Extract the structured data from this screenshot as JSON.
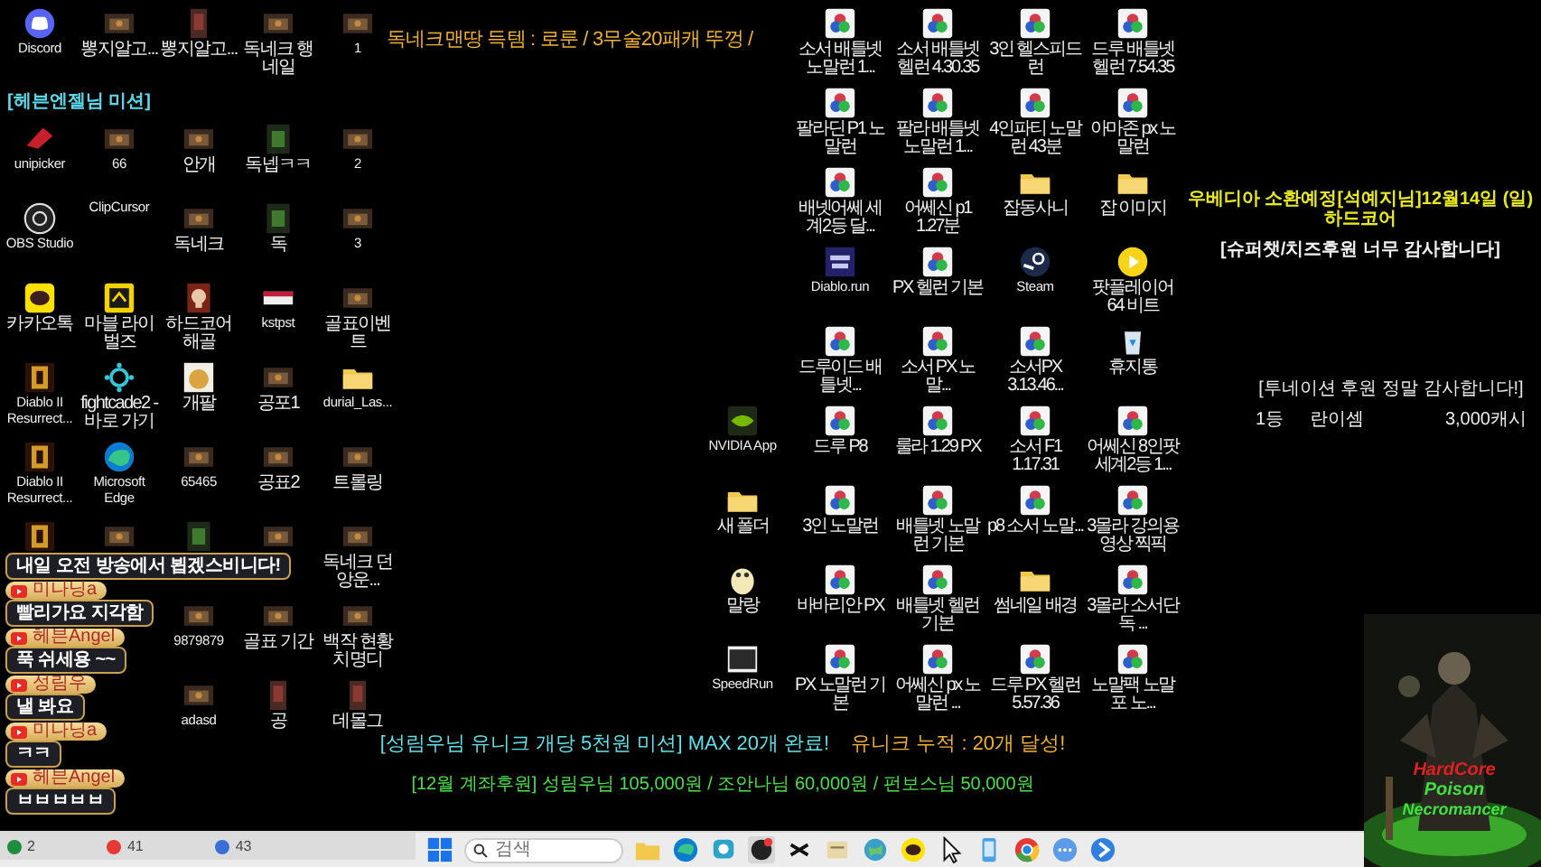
{
  "desktop_left": {
    "first_row": [
      {
        "kind": "discord",
        "label": "Discord"
      },
      {
        "kind": "thumb",
        "label": "뽕지알고..."
      },
      {
        "kind": "doc",
        "label": "뽕지알고..."
      },
      {
        "kind": "thumb",
        "label": "독네크 행네일"
      },
      {
        "kind": "thumb",
        "label": "1"
      }
    ],
    "mission_label": "[헤븐엔젤님 미션]",
    "rows": [
      [
        {
          "kind": "unipicker",
          "label": "unipicker"
        },
        {
          "kind": "thumb",
          "label": "66"
        },
        {
          "kind": "thumb",
          "label": "안개"
        },
        {
          "kind": "thumbg",
          "label": "독넵ㅋㅋ"
        },
        {
          "kind": "thumb",
          "label": "2"
        }
      ],
      [
        {
          "kind": "obs",
          "label": "OBS Studio"
        },
        {
          "kind": "blank",
          "label": "ClipCursor"
        },
        {
          "kind": "thumb",
          "label": "독네크"
        },
        {
          "kind": "thumbg",
          "label": "독"
        },
        {
          "kind": "thumb",
          "label": "3"
        }
      ],
      [
        {
          "kind": "talk",
          "label": "카카오톡"
        },
        {
          "kind": "marvel",
          "label": "마블 라이벌즈"
        },
        {
          "kind": "skull",
          "label": "하드코어 해골"
        },
        {
          "kind": "banner",
          "label": "kstpst"
        },
        {
          "kind": "thumb",
          "label": "골표이벤트"
        }
      ],
      [
        {
          "kind": "diablo",
          "label": "Diablo II Resurrect..."
        },
        {
          "kind": "hub",
          "label": "fightcade2 - 바로 가기"
        },
        {
          "kind": "dog",
          "label": "개팔"
        },
        {
          "kind": "thumb",
          "label": "공포1"
        },
        {
          "kind": "folder",
          "label": "durial_Las..."
        }
      ],
      [
        {
          "kind": "diablo",
          "label": "Diablo II Resurrect..."
        },
        {
          "kind": "edge",
          "label": "Microsoft Edge"
        },
        {
          "kind": "thumb",
          "label": "65465"
        },
        {
          "kind": "thumb",
          "label": "공표2"
        },
        {
          "kind": "thumb",
          "label": "트롤링"
        }
      ],
      [
        {
          "kind": "diablo"
        },
        {
          "kind": "thumb"
        },
        {
          "kind": "thumbg"
        },
        {
          "kind": "thumb"
        },
        {
          "kind": "thumb",
          "label": "독네크 던앙운..."
        }
      ],
      [
        null,
        null,
        {
          "kind": "thumb",
          "label": "9879879"
        },
        {
          "kind": "thumb",
          "label": "골표 기간"
        },
        {
          "kind": "thumb",
          "label": "백작 현황 치명디"
        }
      ],
      [
        null,
        null,
        {
          "kind": "thumb",
          "label": "adasd"
        },
        {
          "kind": "doc",
          "label": "공"
        },
        {
          "kind": "doc",
          "label": "데몰그"
        }
      ]
    ]
  },
  "desktop_right": {
    "rows": [
      [
        null,
        {
          "kind": "circles",
          "label": "소서 배틀넷 노말런 1..."
        },
        {
          "kind": "circles",
          "label": "소서 배틀넷 헬런 4.30.35"
        },
        {
          "kind": "circles",
          "label": "3인 헬스피드런"
        },
        {
          "kind": "circles",
          "label": "드루 배틀넷 헬런 7.54.35"
        }
      ],
      [
        null,
        {
          "kind": "circles",
          "label": "팔라딘 P1 노말런"
        },
        {
          "kind": "circles",
          "label": "팔라 배틀넷 노말런 1..."
        },
        {
          "kind": "circles",
          "label": "4인파티 노말런 43분"
        },
        {
          "kind": "circles",
          "label": "아마존 px 노말런"
        }
      ],
      [
        null,
        {
          "kind": "circles",
          "label": "배넷어쎄 세계2등 달..."
        },
        {
          "kind": "circles",
          "label": "어쎄신 p1 1.27분"
        },
        {
          "kind": "folder",
          "label": "잡동사니"
        },
        {
          "kind": "folder",
          "label": "잡 이미지"
        }
      ],
      [
        null,
        {
          "kind": "run",
          "label": "Diablo.run"
        },
        {
          "kind": "circles",
          "label": "PX 헬런 기본"
        },
        {
          "kind": "steam",
          "label": "Steam"
        },
        {
          "kind": "play",
          "label": "팟플레이어 64 비트"
        }
      ],
      [
        null,
        {
          "kind": "circles",
          "label": "드루이드 배틀넷..."
        },
        {
          "kind": "circles",
          "label": "소서 PX 노말..."
        },
        {
          "kind": "circles",
          "label": "소서PX 3.13.46..."
        },
        {
          "kind": "bin",
          "label": "휴지통"
        }
      ],
      [
        {
          "kind": "nvidia",
          "label": "NVIDIA App"
        },
        {
          "kind": "circles",
          "label": "드루 P8"
        },
        {
          "kind": "circles",
          "label": "룰라 1.29 PX"
        },
        {
          "kind": "circles",
          "label": "소서 F1 1.17.31"
        },
        {
          "kind": "circles",
          "label": "어쎄신 8인팟 세계2등 1..."
        }
      ],
      [
        {
          "kind": "folder",
          "label": "새 폴더"
        },
        {
          "kind": "circles",
          "label": "3인 노말런"
        },
        {
          "kind": "circles",
          "label": "배틀넷 노말런 기본"
        },
        {
          "kind": "circles",
          "label": "p8 소서 노말..."
        },
        {
          "kind": "circles",
          "label": "3몰라 강의용 영상 찍픽"
        }
      ],
      [
        {
          "kind": "mallang",
          "label": "말랑"
        },
        {
          "kind": "circles",
          "label": "바바리안 PX"
        },
        {
          "kind": "circles",
          "label": "배틀넷 헬런 기본"
        },
        {
          "kind": "folder",
          "label": "썸네일 배경"
        },
        {
          "kind": "circles",
          "label": "3몰라 소서단독 ..."
        }
      ],
      [
        {
          "kind": "speed",
          "label": "SpeedRun"
        },
        {
          "kind": "circles",
          "label": "PX 노말런 기본"
        },
        {
          "kind": "circles",
          "label": "어쎄신 px 노말런 ..."
        },
        {
          "kind": "circles",
          "label": "드루 PX 헬런 5.57.36"
        },
        {
          "kind": "circles",
          "label": "노말팩 노말포 노..."
        }
      ]
    ]
  },
  "loot_text": "독네크맨땅 득템 : 로룬 / 3무술20패캐 뚜껑 /",
  "summon_notice": {
    "title": "우베디아 소환예정[석예지님]12월14일 (일) 하드코어",
    "subtitle": "[슈퍼챗/치즈후원 너무 감사합니다]"
  },
  "donation_board": {
    "title": "[투네이션 후원 정말 감사합니다!]",
    "ranking": [
      {
        "rank": "1등",
        "name": "란이셈",
        "amount": "3,000캐시"
      }
    ]
  },
  "mission_text": "[성림우님 유니크 개당 5천원 미션] MAX 20개 완료!",
  "unique_total": "유니크 누적 : 20개 달성!",
  "bank_donations": "[12월 계좌후원] 성림우님 105,000원 / 조안나님 60,000원 / 펀보스님 50,000원",
  "chat": [
    {
      "message": "내일 오전 방송에서 뵙겠스비니다!"
    },
    {
      "name": "미나닝a",
      "message": "빨리가요 지각함"
    },
    {
      "name": "헤븐Angel",
      "message": "푹 쉬세용 ~~"
    },
    {
      "name": "성림우",
      "message": "낼 봐요"
    },
    {
      "name": "미나닝a",
      "message": "ㅋㅋ"
    },
    {
      "name": "헤븐Angel",
      "message": "ㅂㅂㅂㅂㅂ"
    }
  ],
  "chat_stats": [
    {
      "color": "#1e8e3e",
      "count": "2"
    },
    {
      "color": "#e53935",
      "count": "41"
    },
    {
      "color": "#3b6fd8",
      "count": "43"
    }
  ],
  "taskbar": {
    "search": {
      "placeholder": "검색"
    },
    "apps": [
      {
        "kind": "start"
      },
      {
        "kind": "explorer"
      },
      {
        "kind": "edge"
      },
      {
        "kind": "chat"
      },
      {
        "kind": "obs"
      },
      {
        "kind": "capcut"
      },
      {
        "kind": "notes"
      },
      {
        "kind": "globe"
      },
      {
        "kind": "talk"
      },
      {
        "kind": "cursor"
      },
      {
        "kind": "phone"
      },
      {
        "kind": "chrome"
      },
      {
        "kind": "bubble"
      },
      {
        "kind": "arrow"
      }
    ]
  },
  "character_card": {
    "kind": "picture",
    "lines": [
      "HardCore",
      "Poison",
      "Necromancer"
    ]
  }
}
